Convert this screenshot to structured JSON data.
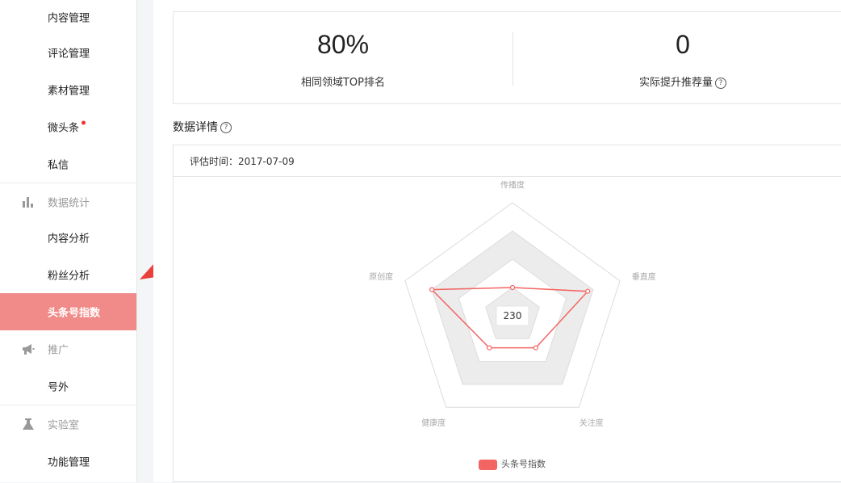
{
  "sidebar": {
    "items": [
      {
        "label": "内容管理"
      },
      {
        "label": "评论管理"
      },
      {
        "label": "素材管理"
      },
      {
        "label": "微头条"
      },
      {
        "label": "私信"
      },
      {
        "label": "数据统计",
        "icon": "bar-chart-icon"
      },
      {
        "label": "内容分析"
      },
      {
        "label": "粉丝分析"
      },
      {
        "label": "头条号指数"
      },
      {
        "label": "推广",
        "icon": "megaphone-icon"
      },
      {
        "label": "号外"
      },
      {
        "label": "实验室",
        "icon": "flask-icon"
      },
      {
        "label": "功能管理"
      }
    ],
    "active": "头条号指数"
  },
  "stats": {
    "top_rank_value": "80%",
    "top_rank_label": "相同领域TOP排名",
    "boost_value": "0",
    "boost_label": "实际提升推荐量"
  },
  "details": {
    "title": "数据详情",
    "eval_time": "评估时间：2017-07-09"
  },
  "chart_data": {
    "type": "radar",
    "axes": [
      "传播度",
      "垂直度",
      "关注度",
      "健康度",
      "原创度"
    ],
    "series": [
      {
        "name": "头条号指数",
        "values": [
          0.25,
          0.7,
          0.35,
          0.35,
          0.75
        ]
      }
    ],
    "center_value": "230",
    "rings": 4,
    "colors": {
      "series": "#f26563",
      "band": "#ececec"
    }
  }
}
